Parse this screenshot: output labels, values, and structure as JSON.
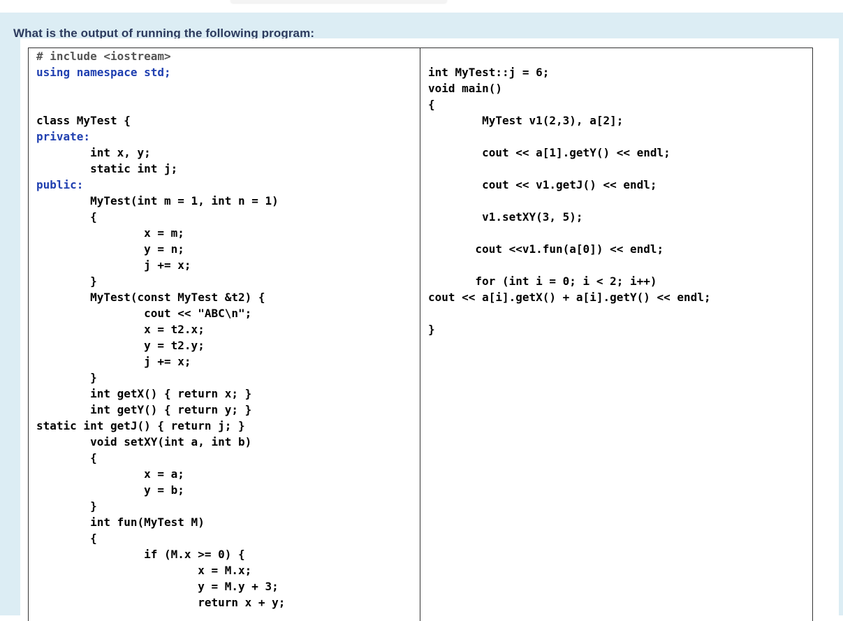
{
  "question": "What is the output of running  the following program:",
  "code_left": [
    "# include <iostream>",
    "using namespace std;",
    "class MyTest {",
    "private:",
    "        int x, y;",
    "        static int j;",
    "public:",
    "        MyTest(int m = 1, int n = 1)",
    "        {",
    "                x = m;",
    "                y = n;",
    "                j += x;",
    "        }",
    "        MyTest(const MyTest &t2) {",
    "                cout << \"ABC\\n\";",
    "                x = t2.x;",
    "                y = t2.y;",
    "                j += x;",
    "        }",
    "        int getX() { return x; }",
    "        int getY() { return y; }",
    "static int getJ() { return j; }",
    "        void setXY(int a, int b)",
    "        {",
    "                x = a;",
    "                y = b;",
    "        }",
    "        int fun(MyTest M)",
    "        {",
    "                if (M.x >= 0) {",
    "                        x = M.x;",
    "                        y = M.y + 3;",
    "                        return x + y;"
  ],
  "code_right": [
    "int MyTest::j = 6;",
    "void main()",
    "{",
    "        MyTest v1(2,3), a[2];",
    "        cout << a[1].getY() << endl;",
    "        cout << v1.getJ() << endl;",
    "        v1.setXY(3, 5);",
    "       cout <<v1.fun(a[0]) << endl;",
    "       for (int i = 0; i < 2; i++)",
    "cout << a[i].getX() + a[i].getY() << endl;",
    "}"
  ]
}
